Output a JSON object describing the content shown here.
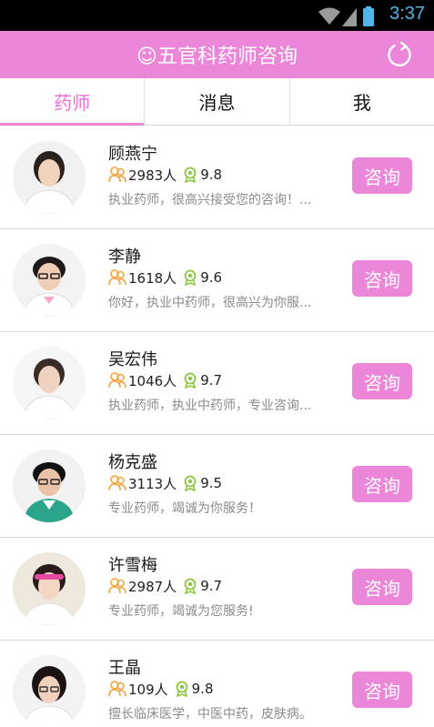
{
  "status_bar": {
    "time": "3:37",
    "icons": [
      "wifi-icon",
      "cellular-signal-icon",
      "battery-icon"
    ]
  },
  "header": {
    "title": "☺五官科药师咨询",
    "refresh_icon": "refresh-icon"
  },
  "tabs": [
    {
      "label": "药师",
      "active": true
    },
    {
      "label": "消息",
      "active": false
    },
    {
      "label": "我",
      "active": false
    }
  ],
  "pharmacists": [
    {
      "name": "顾燕宁",
      "count": "2983人",
      "score": "9.8",
      "desc": "执业药师，很高兴接受您的咨询！...",
      "action": "咨询"
    },
    {
      "name": "李静",
      "count": "1618人",
      "score": "9.6",
      "desc": "你好，执业中药师，很高兴为你服...",
      "action": "咨询"
    },
    {
      "name": "吴宏伟",
      "count": "1046人",
      "score": "9.7",
      "desc": "执业药师，执业中药师，专业咨询...",
      "action": "咨询"
    },
    {
      "name": "杨克盛",
      "count": "3113人",
      "score": "9.5",
      "desc": "专业药师，竭诚为你服务！",
      "action": "咨询"
    },
    {
      "name": "许雪梅",
      "count": "2987人",
      "score": "9.7",
      "desc": "专业药师，竭诚为您服务!",
      "action": "咨询"
    },
    {
      "name": "王晶",
      "count": "109人",
      "score": "9.8",
      "desc": "擅长临床医学，中医中药，皮肤病。",
      "action": "咨询"
    }
  ],
  "colors": {
    "accent": "#ec86d9",
    "accent_text": "#ec6fd2",
    "people_icon": "#f2a33a",
    "medal_icon": "#8cc63f",
    "status_time": "#4fb4e6"
  }
}
